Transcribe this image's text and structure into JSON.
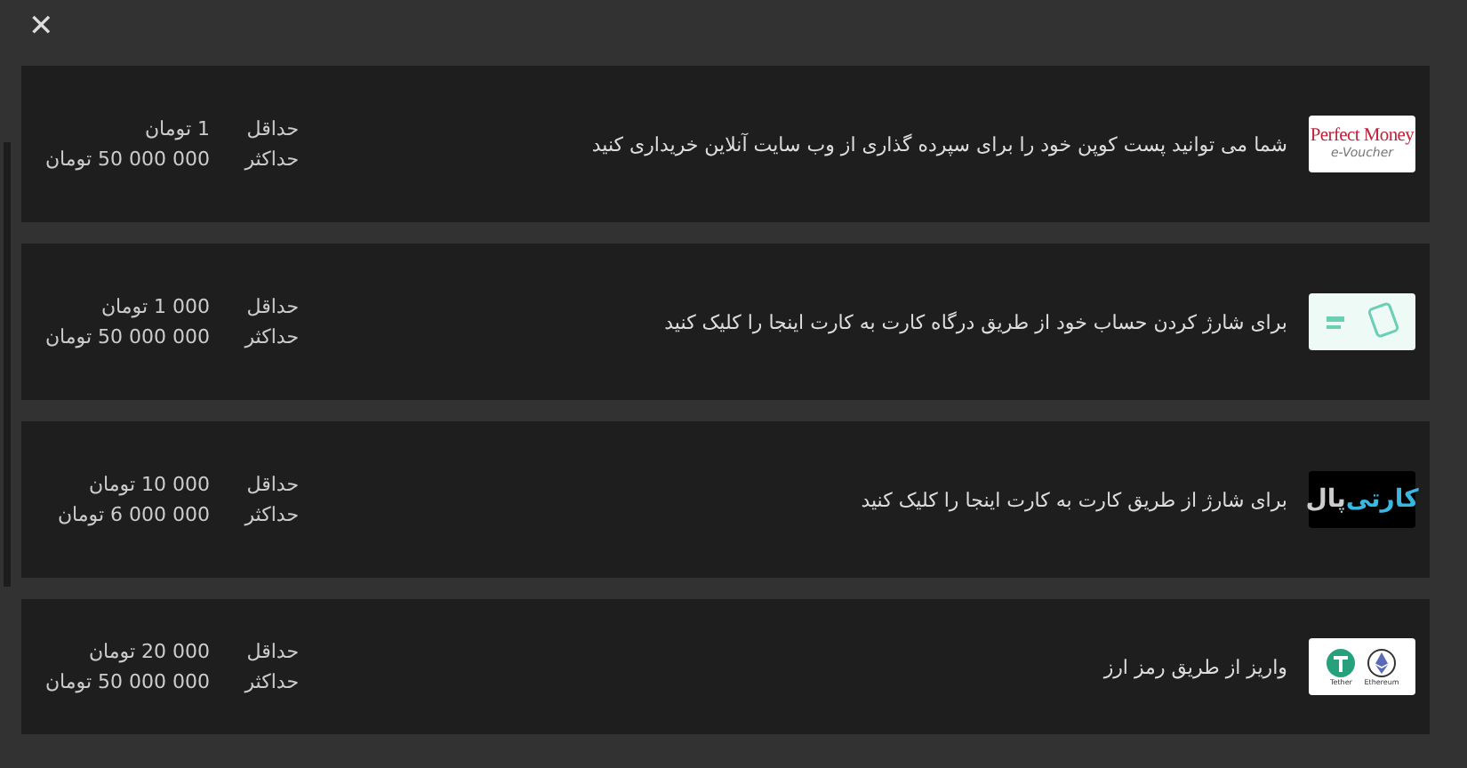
{
  "close_label": "✕",
  "methods": [
    {
      "logo": {
        "kind": "perfect-money",
        "texts": [
          "Perfect Money",
          "e-Voucher"
        ]
      },
      "description": "شما می توانید پست کوپن خود را برای سپرده گذاری از وب سایت آنلاین خریداری کنید",
      "min_label": "حداقل",
      "min_value": "1 تومان",
      "max_label": "حداکثر",
      "max_value": "50 000 000 تومان"
    },
    {
      "logo": {
        "kind": "gateway"
      },
      "description": "برای شارژ کردن حساب خود از طریق درگاه کارت به کارت اینجا را کلیک کنید",
      "min_label": "حداقل",
      "min_value": "1 000 تومان",
      "max_label": "حداکثر",
      "max_value": "50 000 000 تومان"
    },
    {
      "logo": {
        "kind": "kartipal",
        "texts": [
          "کارتی",
          "پال"
        ]
      },
      "description": "برای شارژ از طریق کارت به کارت اینجا را کلیک کنید",
      "min_label": "حداقل",
      "min_value": "10 000 تومان",
      "max_label": "حداکثر",
      "max_value": "6 000 000 تومان"
    },
    {
      "logo": {
        "kind": "crypto",
        "texts": [
          "Tether",
          "Ethereum"
        ]
      },
      "description": "واریز از طریق رمز ارز",
      "min_label": "حداقل",
      "min_value": "20 000 تومان",
      "max_label": "حداکثر",
      "max_value": "50 000 000 تومان"
    }
  ]
}
